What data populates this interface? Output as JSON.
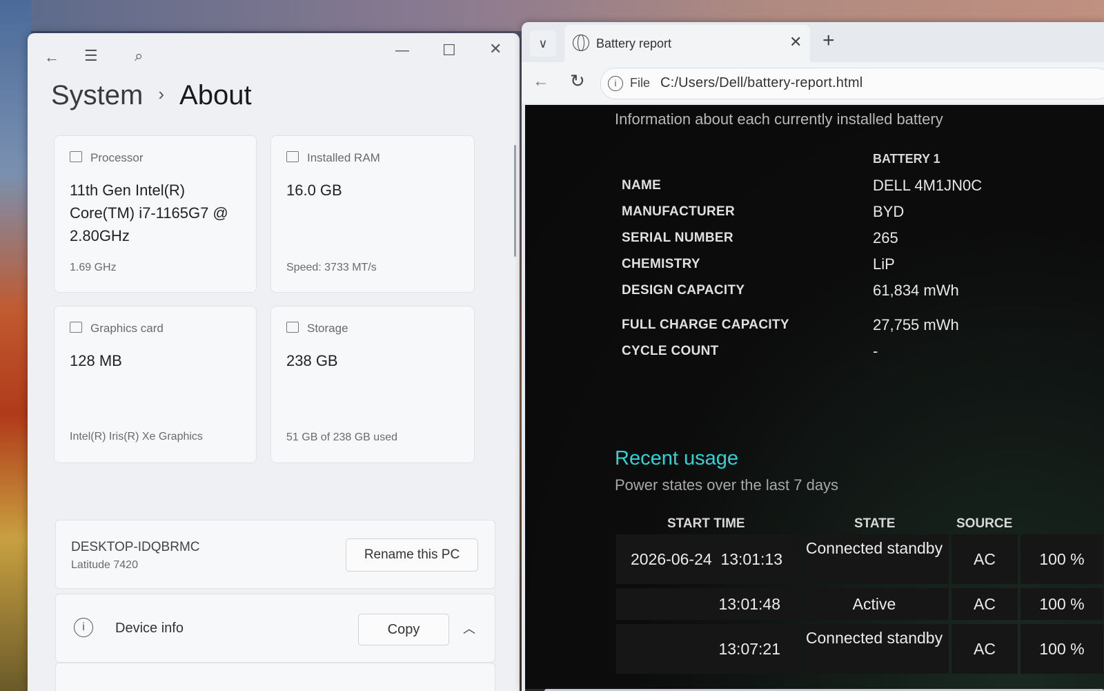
{
  "settings": {
    "breadcrumb_parent": "System",
    "breadcrumb_sep": "›",
    "page_title": "About",
    "icons": {
      "back": "back-arrow-icon",
      "menu": "hamburger-menu-icon",
      "search": "search-icon",
      "minimize": "minimize-icon",
      "maximize": "maximize-icon",
      "close": "close-icon"
    },
    "specs": [
      {
        "label": "Processor",
        "value": "11th Gen Intel(R) Core(TM) i7-1165G7 @ 2.80GHz",
        "sub": "1.69 GHz",
        "icon": "processor-icon"
      },
      {
        "label": "Installed RAM",
        "value": "16.0 GB",
        "sub": "Speed: 3733 MT/s",
        "icon": "ram-icon"
      },
      {
        "label": "Graphics card",
        "value": "128 MB",
        "sub": "Intel(R) Iris(R) Xe Graphics",
        "icon": "graphics-card-icon"
      },
      {
        "label": "Storage",
        "value": "238 GB",
        "sub": "51 GB of 238 GB used",
        "icon": "storage-icon"
      }
    ],
    "pc_name": "DESKTOP-IDQBRMC",
    "pc_model": "Latitude 7420",
    "rename_button": "Rename this PC",
    "device_info_label": "Device info",
    "copy_button": "Copy"
  },
  "browser": {
    "tab_title": "Battery report",
    "new_tab": "+",
    "address_prefix": "File",
    "url": "C:/Users/Dell/battery-report.html",
    "report": {
      "intro": "Information about each currently installed battery",
      "battery_header": "BATTERY 1",
      "rows": [
        {
          "key": "NAME",
          "value": "DELL 4M1JN0C"
        },
        {
          "key": "MANUFACTURER",
          "value": "BYD"
        },
        {
          "key": "SERIAL NUMBER",
          "value": "265"
        },
        {
          "key": "CHEMISTRY",
          "value": "LiP"
        },
        {
          "key": "DESIGN CAPACITY",
          "value": "61,834 mWh"
        },
        {
          "key": "FULL CHARGE CAPACITY",
          "value": "27,755 mWh"
        },
        {
          "key": "CYCLE COUNT",
          "value": "-"
        }
      ],
      "recent_title": "Recent usage",
      "recent_sub": "Power states over the last 7 days",
      "columns": [
        "START TIME",
        "STATE",
        "SOURCE"
      ],
      "usage": [
        {
          "date": "2026-06-24",
          "time": "13:01:13",
          "state": "Connected standby",
          "source": "AC",
          "capacity": "100 %"
        },
        {
          "date": "",
          "time": "13:01:48",
          "state": "Active",
          "source": "AC",
          "capacity": "100 %"
        },
        {
          "date": "",
          "time": "13:07:21",
          "state": "Connected standby",
          "source": "AC",
          "capacity": "100 %"
        }
      ]
    }
  }
}
